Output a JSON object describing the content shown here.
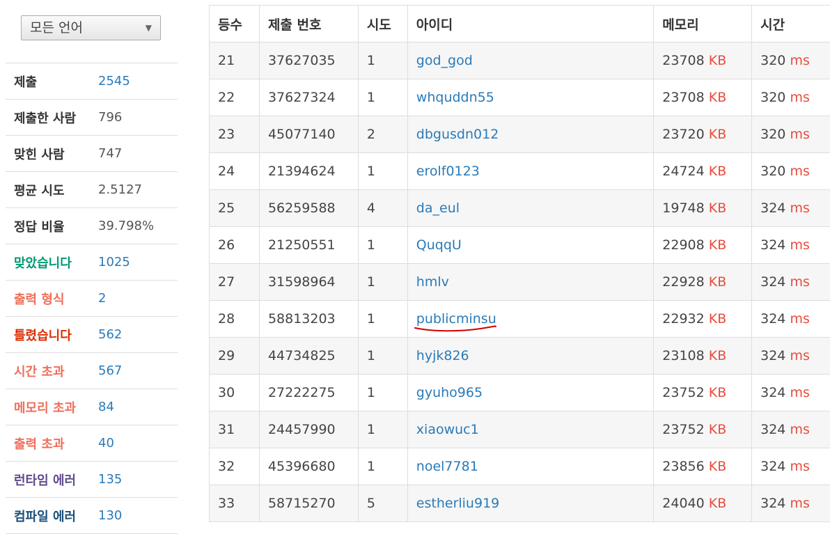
{
  "language_select": {
    "value": "모든 언어",
    "caret": "▼"
  },
  "stats": [
    {
      "label": "제출",
      "value": "2545",
      "label_color": "default",
      "value_link": true
    },
    {
      "label": "제출한 사람",
      "value": "796",
      "label_color": "default",
      "value_link": false
    },
    {
      "label": "맞힌 사람",
      "value": "747",
      "label_color": "default",
      "value_link": false
    },
    {
      "label": "평균 시도",
      "value": "2.5127",
      "label_color": "default",
      "value_link": false
    },
    {
      "label": "정답 비율",
      "value": "39.798%",
      "label_color": "default",
      "value_link": false
    },
    {
      "label": "맞았습니다",
      "value": "1025",
      "label_color": "green",
      "value_link": true
    },
    {
      "label": "출력 형식",
      "value": "2",
      "label_color": "salmon",
      "value_link": true
    },
    {
      "label": "틀렸습니다",
      "value": "562",
      "label_color": "red",
      "value_link": true
    },
    {
      "label": "시간 초과",
      "value": "567",
      "label_color": "salmon",
      "value_link": true
    },
    {
      "label": "메모리 초과",
      "value": "84",
      "label_color": "salmon",
      "value_link": true
    },
    {
      "label": "출력 초과",
      "value": "40",
      "label_color": "salmon",
      "value_link": true
    },
    {
      "label": "런타임 에러",
      "value": "135",
      "label_color": "purple",
      "value_link": true
    },
    {
      "label": "컴파일 에러",
      "value": "130",
      "label_color": "navy",
      "value_link": true
    }
  ],
  "table": {
    "headers": [
      "등수",
      "제출 번호",
      "시도",
      "아이디",
      "메모리",
      "시간"
    ],
    "memory_unit": "KB",
    "time_unit": "ms",
    "rows": [
      {
        "rank": "21",
        "submission": "37627035",
        "tries": "1",
        "user": "god_god",
        "memory": "23708",
        "time": "320"
      },
      {
        "rank": "22",
        "submission": "37627324",
        "tries": "1",
        "user": "whquddn55",
        "memory": "23708",
        "time": "320"
      },
      {
        "rank": "23",
        "submission": "45077140",
        "tries": "2",
        "user": "dbgusdn012",
        "memory": "23720",
        "time": "320"
      },
      {
        "rank": "24",
        "submission": "21394624",
        "tries": "1",
        "user": "erolf0123",
        "memory": "24724",
        "time": "320"
      },
      {
        "rank": "25",
        "submission": "56259588",
        "tries": "4",
        "user": "da_eul",
        "memory": "19748",
        "time": "324"
      },
      {
        "rank": "26",
        "submission": "21250551",
        "tries": "1",
        "user": "QuqqU",
        "memory": "22908",
        "time": "324"
      },
      {
        "rank": "27",
        "submission": "31598964",
        "tries": "1",
        "user": "hmlv",
        "memory": "22928",
        "time": "324"
      },
      {
        "rank": "28",
        "submission": "58813203",
        "tries": "1",
        "user": "publicminsu",
        "memory": "22932",
        "time": "324",
        "underlined": true
      },
      {
        "rank": "29",
        "submission": "44734825",
        "tries": "1",
        "user": "hyjk826",
        "memory": "23108",
        "time": "324"
      },
      {
        "rank": "30",
        "submission": "27222275",
        "tries": "1",
        "user": "gyuho965",
        "memory": "23752",
        "time": "324"
      },
      {
        "rank": "31",
        "submission": "24457990",
        "tries": "1",
        "user": "xiaowuc1",
        "memory": "23752",
        "time": "324"
      },
      {
        "rank": "32",
        "submission": "45396680",
        "tries": "1",
        "user": "noel7781",
        "memory": "23856",
        "time": "324"
      },
      {
        "rank": "33",
        "submission": "58715270",
        "tries": "5",
        "user": "estherliu919",
        "memory": "24040",
        "time": "324"
      }
    ]
  },
  "colors": {
    "link": "#2a7ab8",
    "unit": "#e74c3c",
    "green": "#009874",
    "salmon": "#f06e5a",
    "red": "#dd2c00",
    "purple": "#5f4b8b",
    "navy": "#1a4f7a",
    "underline_mark": "#d00000"
  }
}
